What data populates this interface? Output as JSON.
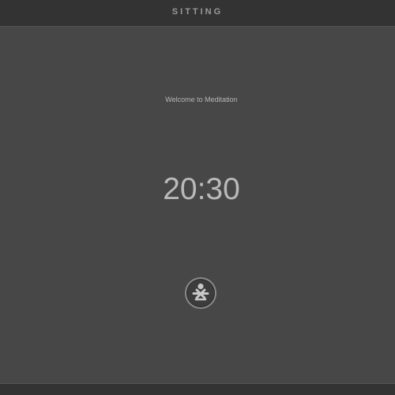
{
  "header": {
    "title": "SITTING"
  },
  "main": {
    "welcome_text": "Welcome to Meditation",
    "timer_value": "20:30",
    "start_button_icon": "meditation-figure-icon"
  },
  "colors": {
    "background": "#474747",
    "header_background": "#333333",
    "text": "#b9b9b9"
  }
}
